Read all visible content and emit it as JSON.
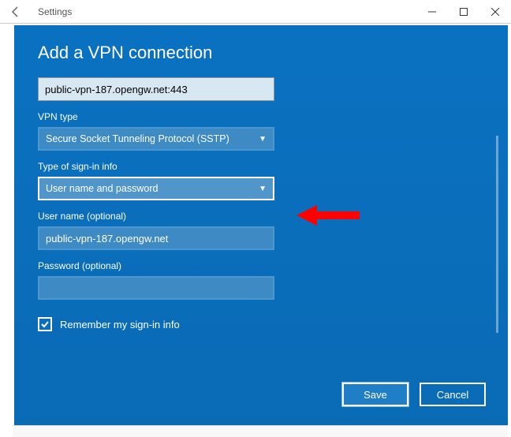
{
  "titlebar": {
    "app_title": "Settings"
  },
  "modal": {
    "heading": "Add a VPN connection",
    "conn_name_value": "public-vpn-187.opengw.net:443",
    "vpn_type_label": "VPN type",
    "vpn_type_value": "Secure Socket Tunneling Protocol (SSTP)",
    "signin_type_label": "Type of sign-in info",
    "signin_type_value": "User name and password",
    "username_label": "User name (optional)",
    "username_value": "public-vpn-187.opengw.net",
    "password_label": "Password (optional)",
    "password_value": "",
    "remember_label": "Remember my sign-in info",
    "remember_checked": true,
    "save_label": "Save",
    "cancel_label": "Cancel"
  }
}
